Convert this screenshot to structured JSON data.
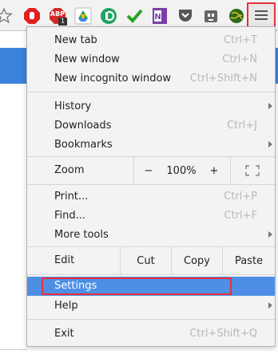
{
  "toolbar": {
    "extensions": [
      {
        "icon": "star-outline-icon"
      },
      {
        "icon": "stop-sign-icon"
      },
      {
        "icon": "adblock-plus-icon",
        "text": "ABP",
        "badge": "1"
      },
      {
        "icon": "google-drive-icon"
      },
      {
        "icon": "evernote-d-icon"
      },
      {
        "icon": "green-checkmark-icon"
      },
      {
        "icon": "onenote-icon"
      },
      {
        "icon": "pocket-icon"
      },
      {
        "icon": "robot-icon"
      },
      {
        "icon": "globe-icon"
      }
    ],
    "menu_button": {
      "icon": "hamburger-menu-icon"
    }
  },
  "menu": {
    "new_tab": {
      "label": "New tab",
      "shortcut": "Ctrl+T"
    },
    "new_window": {
      "label": "New window",
      "shortcut": "Ctrl+N"
    },
    "new_incognito": {
      "label": "New incognito window",
      "shortcut": "Ctrl+Shift+N"
    },
    "history": {
      "label": "History"
    },
    "downloads": {
      "label": "Downloads",
      "shortcut": "Ctrl+J"
    },
    "bookmarks": {
      "label": "Bookmarks"
    },
    "zoom": {
      "label": "Zoom",
      "minus": "−",
      "level": "100%",
      "plus": "+"
    },
    "print": {
      "label": "Print...",
      "shortcut": "Ctrl+P"
    },
    "find": {
      "label": "Find...",
      "shortcut": "Ctrl+F"
    },
    "more_tools": {
      "label": "More tools"
    },
    "edit": {
      "label": "Edit",
      "cut": "Cut",
      "copy": "Copy",
      "paste": "Paste"
    },
    "settings": {
      "label": "Settings"
    },
    "help": {
      "label": "Help"
    },
    "exit": {
      "label": "Exit",
      "shortcut": "Ctrl+Shift+Q"
    }
  },
  "colors": {
    "highlight": "#4d8fe4",
    "annotation_red": "#e8303a"
  }
}
